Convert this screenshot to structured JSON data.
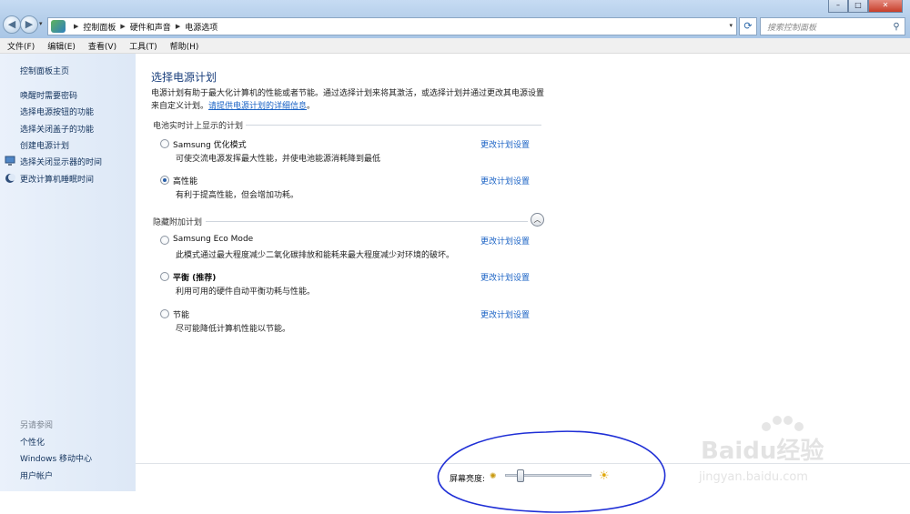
{
  "address_bar": {
    "breadcrumbs": [
      "控制面板",
      "硬件和声音",
      "电源选项"
    ],
    "search_placeholder": "搜索控制面板"
  },
  "menu": [
    "文件(F)",
    "编辑(E)",
    "查看(V)",
    "工具(T)",
    "帮助(H)"
  ],
  "sidebar": {
    "home": "控制面板主页",
    "links": [
      "唤醒时需要密码",
      "选择电源按钮的功能",
      "选择关闭盖子的功能",
      "创建电源计划",
      "选择关闭显示器的时间",
      "更改计算机睡眠时间"
    ],
    "see_also_title": "另请参阅",
    "see_also": [
      "个性化",
      "Windows 移动中心",
      "用户帐户"
    ]
  },
  "main": {
    "title": "选择电源计划",
    "description": "电源计划有助于最大化计算机的性能或者节能。通过选择计划来将其激活，或选择计划并通过更改其电源设置来自定义计划。",
    "description_link": "请提供电源计划的详细信息",
    "battery_plans_header": "电池实时计上显示的计划",
    "hidden_plans_header": "隐藏附加计划",
    "change_link": "更改计划设置",
    "plans": [
      {
        "name": "Samsung 优化模式",
        "desc": "可使交流电源发挥最大性能，并使电池能源消耗降到最低",
        "selected": false
      },
      {
        "name": "高性能",
        "desc": "有利于提高性能，但会增加功耗。",
        "selected": true
      },
      {
        "name": "Samsung Eco Mode",
        "desc": "此模式通过最大程度减少二氧化碳排放和能耗来最大程度减少对环境的破坏。",
        "selected": false
      },
      {
        "name": "平衡 (推荐)",
        "desc": "利用可用的硬件自动平衡功耗与性能。",
        "selected": false
      },
      {
        "name": "节能",
        "desc": "尽可能降低计算机性能以节能。",
        "selected": false
      }
    ]
  },
  "brightness": {
    "label": "屏幕亮度:",
    "level": 0.18
  },
  "watermark": {
    "logo": "Baidu经验",
    "url": "jingyan.baidu.com"
  },
  "colors": {
    "link": "#1b63c5",
    "title": "#1a3f7c",
    "annotation_oval": "#1f2fd6"
  }
}
